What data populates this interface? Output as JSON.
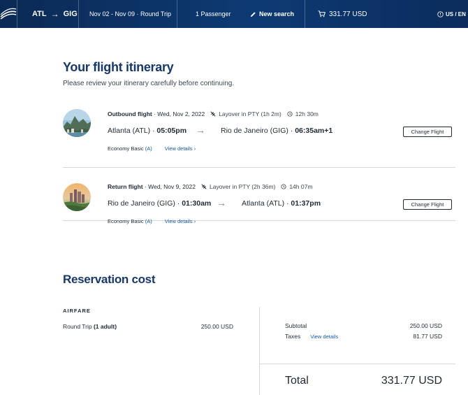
{
  "header": {
    "origin": "ATL",
    "destination": "GIG",
    "dates": "Nov 02 - Nov 09 · Round Trip",
    "passengers": "1 Passenger",
    "new_search": "New search",
    "cart_total": "331.77 USD",
    "locale": "US / EN"
  },
  "itinerary": {
    "title": "Your flight itinerary",
    "subtitle": "Please review your itinerary carefully before continuing.",
    "flights": [
      {
        "label": "Outbound flight",
        "date": "· Wed, Nov 2, 2022",
        "layover": "Layover in PTY (1h 2m)",
        "duration": "12h 30m",
        "from_city": "Atlanta (ATL)",
        "from_time": "05:05pm",
        "to_city": "Rio de Janeiro (GIG)",
        "to_time": "06:35am+1",
        "cabin": "Economy Basic",
        "cabin_code": "(A)",
        "view_details": "View details",
        "change_label": "Change Flight"
      },
      {
        "label": "Return flight",
        "date": "· Wed, Nov 9, 2022",
        "layover": "Layover in PTY (2h 36m)",
        "duration": "14h 07m",
        "from_city": "Rio de Janeiro (GIG)",
        "from_time": "01:30am",
        "to_city": "Atlanta (ATL)",
        "to_time": "01:37pm",
        "cabin": "Economy Basic",
        "cabin_code": "(A)",
        "view_details": "View details",
        "change_label": "Change Flight"
      }
    ]
  },
  "cost": {
    "title": "Reservation cost",
    "airfare_heading": "AIRFARE",
    "airfare_label": "Round Trip",
    "airfare_qualifier": "(1 adult)",
    "airfare_amount": "250.00 USD",
    "subtotal_label": "Subtotal",
    "subtotal_amount": "250.00 USD",
    "taxes_label": "Taxes",
    "taxes_link": "View details",
    "taxes_amount": "81.77 USD",
    "total_label": "Total",
    "total_amount": "331.77 USD"
  },
  "colors": {
    "brand_navy": "#0b2a55",
    "heading_blue": "#17386b",
    "link_blue": "#1557a8"
  }
}
